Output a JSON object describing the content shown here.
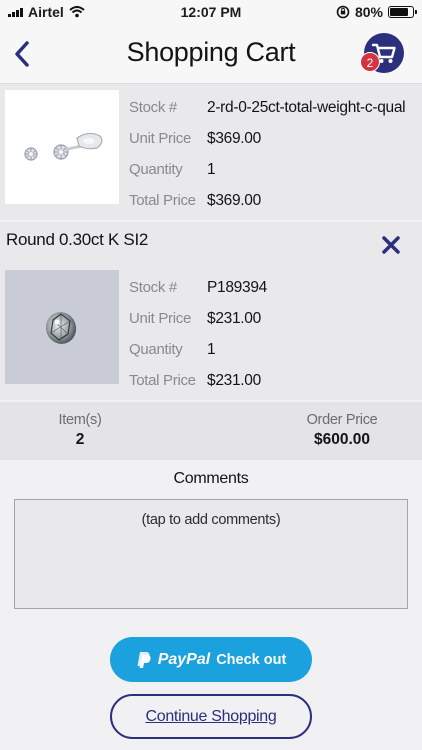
{
  "status_bar": {
    "carrier": "Airtel",
    "time": "12:07 PM",
    "battery_percent": "80%",
    "battery_level": 0.8
  },
  "nav": {
    "title": "Shopping Cart",
    "back_icon": "chevron-left-icon",
    "cart_icon": "shopping-cart-icon",
    "cart_badge": "2"
  },
  "labels": {
    "stock": "Stock #",
    "unit_price": "Unit Price",
    "quantity": "Quantity",
    "total_price": "Total Price"
  },
  "items": [
    {
      "title": "",
      "image": "diamond-stud-earrings",
      "stock": "2-rd-0-25ct-total-weight-c-qual",
      "unit_price": "$369.00",
      "quantity": "1",
      "total_price": "$369.00"
    },
    {
      "title": "Round 0.30ct K SI2",
      "image": "loose-round-diamond",
      "remove_icon": "close-icon",
      "stock": "P189394",
      "unit_price": "$231.00",
      "quantity": "1",
      "total_price": "$231.00"
    }
  ],
  "summary": {
    "items_label": "Item(s)",
    "items_value": "2",
    "order_price_label": "Order Price",
    "order_price_value": "$600.00"
  },
  "comments": {
    "label": "Comments",
    "placeholder": "(tap to add comments)"
  },
  "buttons": {
    "paypal_word": "PayPal",
    "paypal_action": "Check out",
    "continue": "Continue Shopping"
  },
  "colors": {
    "brand_navy": "#2b2f7c",
    "paypal_blue": "#1ba1dd",
    "badge_red": "#d63340"
  }
}
